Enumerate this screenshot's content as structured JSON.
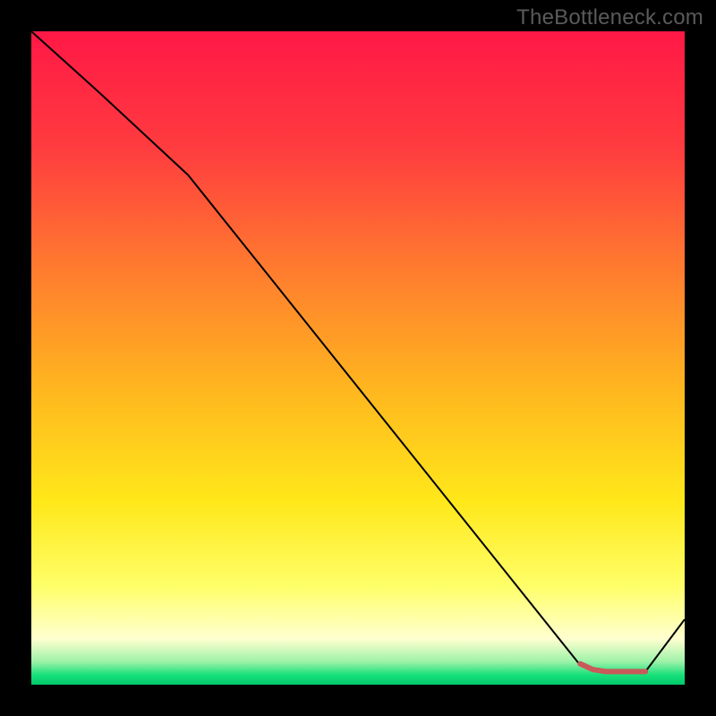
{
  "watermark": "TheBottleneck.com",
  "chart_data": {
    "type": "line",
    "title": "",
    "xlabel": "",
    "ylabel": "",
    "xlim": [
      0,
      100
    ],
    "ylim": [
      0,
      100
    ],
    "grid": false,
    "background_gradient": {
      "stops": [
        {
          "offset": 0.0,
          "color": "#ff1846"
        },
        {
          "offset": 0.18,
          "color": "#ff3c3f"
        },
        {
          "offset": 0.36,
          "color": "#ff7a2f"
        },
        {
          "offset": 0.55,
          "color": "#ffb71f"
        },
        {
          "offset": 0.72,
          "color": "#ffe81a"
        },
        {
          "offset": 0.85,
          "color": "#ffff6a"
        },
        {
          "offset": 0.93,
          "color": "#ffffd0"
        },
        {
          "offset": 0.965,
          "color": "#9cf2a8"
        },
        {
          "offset": 0.985,
          "color": "#18e07a"
        },
        {
          "offset": 1.0,
          "color": "#00c96b"
        }
      ]
    },
    "series": [
      {
        "name": "bottleneck-curve",
        "stroke": "#000000",
        "stroke_width": 2,
        "x": [
          0,
          10,
          24,
          84,
          88,
          94,
          100
        ],
        "y": [
          100,
          91,
          78,
          3,
          2,
          2,
          10
        ]
      },
      {
        "name": "optimal-range-marker",
        "stroke": "#c85a5a",
        "stroke_width": 6,
        "linecap": "round",
        "x": [
          84,
          86,
          88,
          90,
          92,
          94
        ],
        "y": [
          3.2,
          2.3,
          2.0,
          2.0,
          2.0,
          2.0
        ]
      }
    ]
  }
}
